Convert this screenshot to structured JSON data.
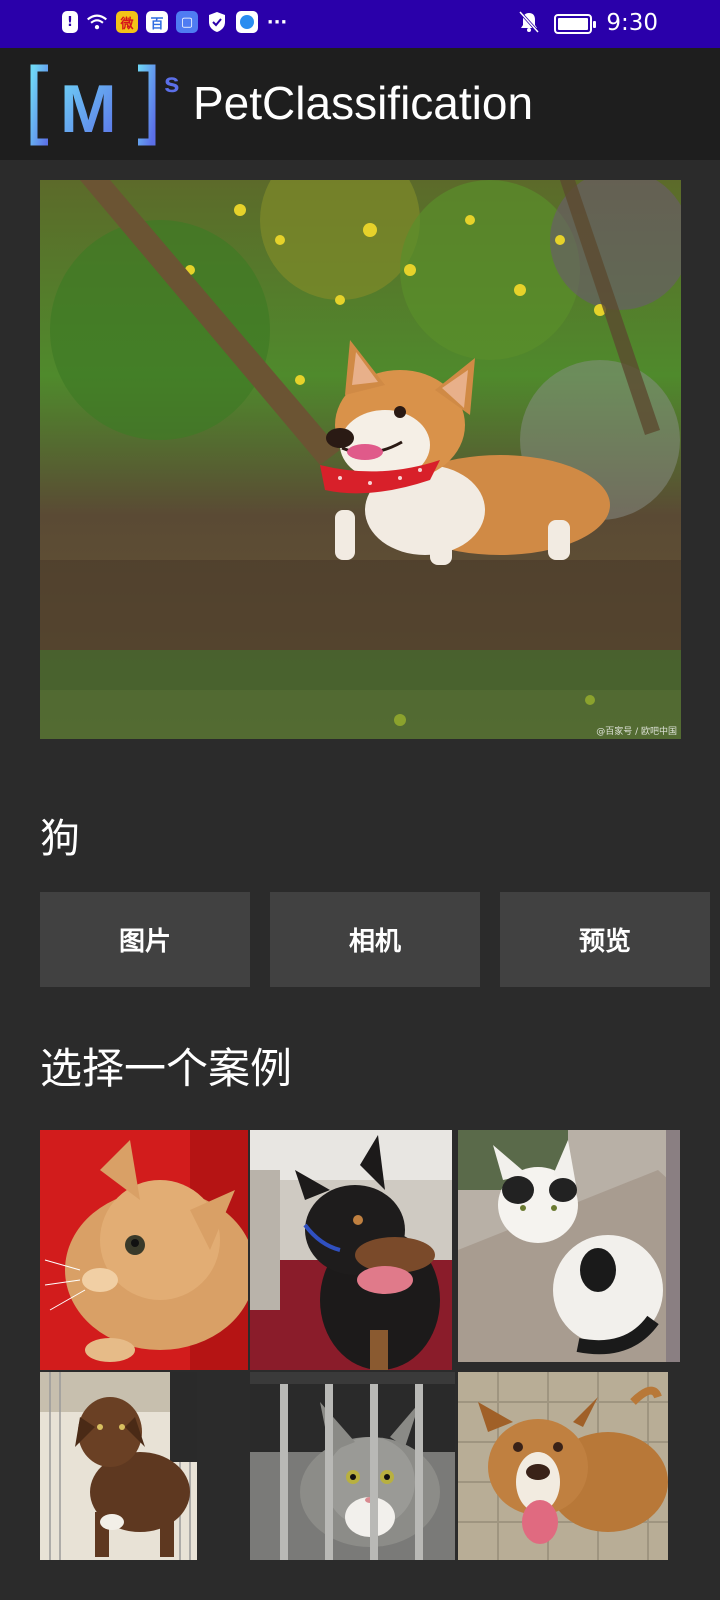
{
  "status_bar": {
    "time": "9:30",
    "left_icons": [
      "alert-icon",
      "wifi-icon",
      "weibo-icon",
      "baidu-icon",
      "store-icon",
      "shield-icon",
      "browser-icon",
      "more-icon"
    ],
    "right_icons": [
      "bell-muted-icon",
      "battery-icon"
    ],
    "more": "···"
  },
  "app_bar": {
    "logo_text": "[M]",
    "logo_superscript": "s",
    "title": "PetClassification"
  },
  "hero": {
    "subject": "corgi dog photo",
    "watermark": "@百家号 / 欧吧中国"
  },
  "result": {
    "label": "狗"
  },
  "buttons": {
    "gallery": "图片",
    "camera": "相机",
    "preview": "预览"
  },
  "examples": {
    "title": "选择一个案例",
    "items": [
      "orange cat on red blanket",
      "doberman dog",
      "white and black kitten",
      "brown dog in kennel",
      "tabby cat behind bars",
      "pit bull dog on blanket"
    ]
  },
  "colors": {
    "status_bar": "#2a00aa",
    "app_bar": "#1e1e1e",
    "background": "#2b2b2b",
    "button": "#414141"
  }
}
